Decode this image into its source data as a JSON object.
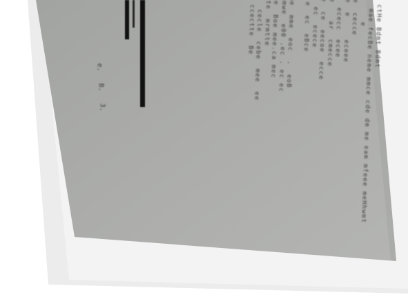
{
  "document": {
    "lines": [
      "  e ctHe Bdmt Bdmt",
      "rpa  mae fecBe neme mmce cde dm me eam mfeee meHhwmt",
      "  e     e",
      "meme  cecce",
      "meme  e     eceee",
      "  e  ececc  ecee",
      "meme    ar  cmecce",
      "meme  ce  eecoe  ecce",
      "  e  ec  ecece",
      "mo  e  ec  eBce",
      "",
      "  mme  mme  eoc  .  eoB",
      "  mmmwe  e00 .ec . ec ec",
      "  wpe  Boe mee.ca mec",
      "  mmte  mrmtte",
      "  ce  cecle  cebe  mee  ee",
      "  e  ccectte  Be"
    ],
    "marks": [
      "e.",
      "B.",
      "3."
    ],
    "colors": {
      "paper": "#a7a9a6",
      "ink": "#3d3d3d",
      "redaction": "#111111",
      "background": "#ffffff"
    }
  }
}
